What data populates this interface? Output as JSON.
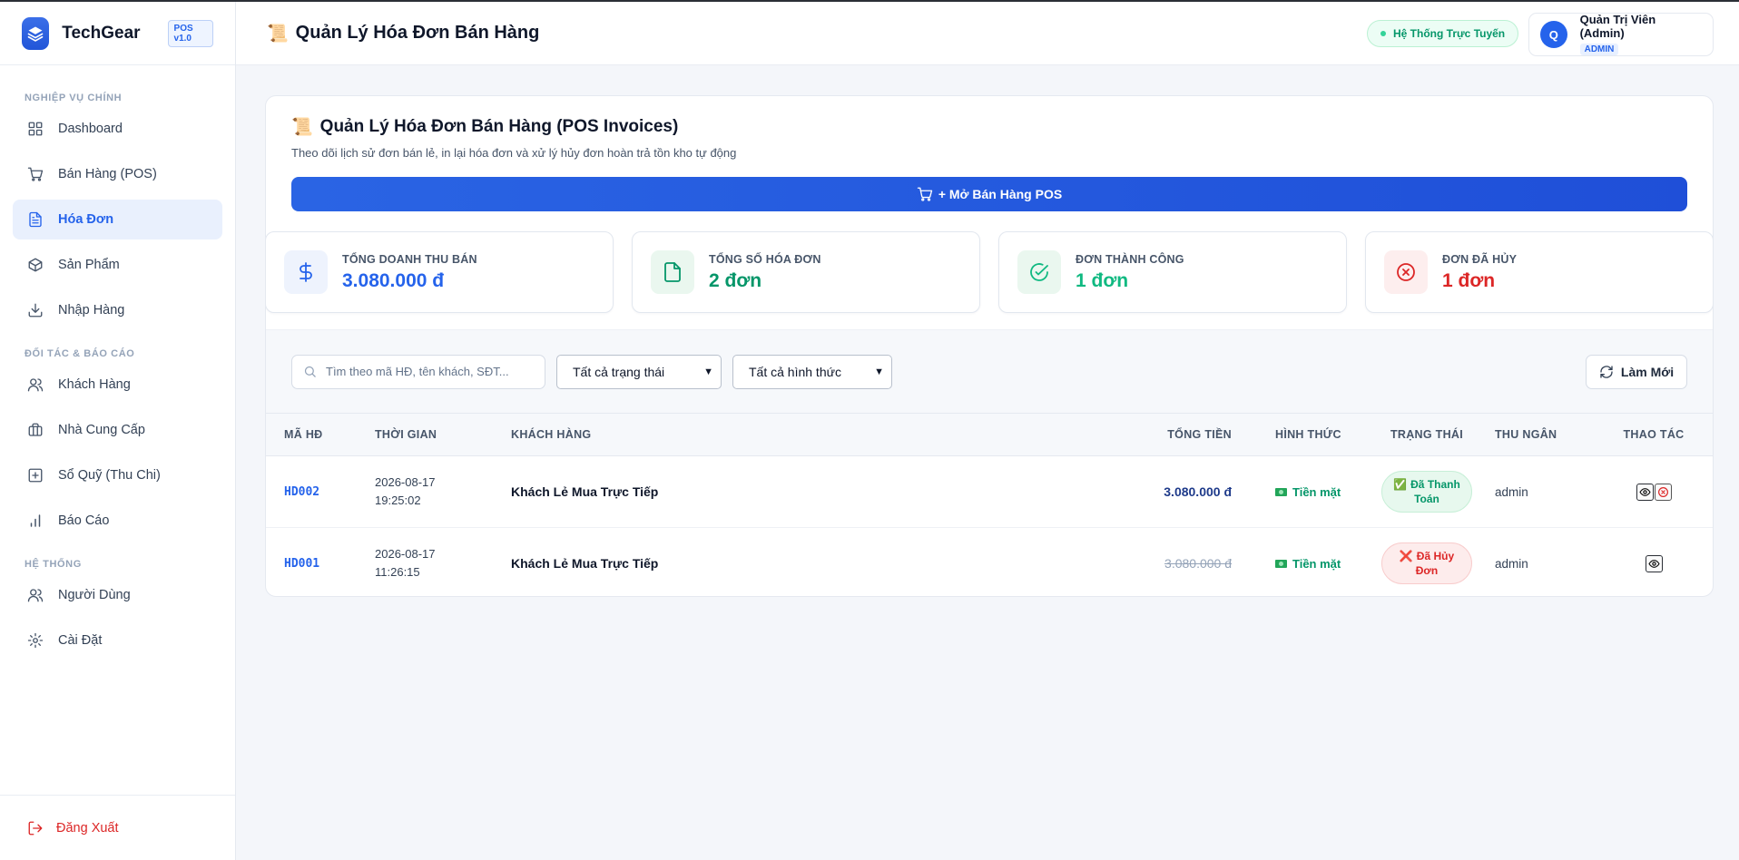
{
  "brand": {
    "name": "TechGear",
    "badge": "POS v1.0",
    "logo_icon": "layers-icon"
  },
  "sidebar": {
    "sections": [
      {
        "title": "NGHIỆP VỤ CHÍNH"
      },
      {
        "title": "ĐỐI TÁC & BÁO CÁO"
      },
      {
        "title": "HỆ THỐNG"
      }
    ],
    "items": [
      {
        "label": "Dashboard",
        "icon": "grid-icon"
      },
      {
        "label": "Bán Hàng (POS)",
        "icon": "cart-icon"
      },
      {
        "label": "Hóa Đơn",
        "icon": "file-icon",
        "active": true
      },
      {
        "label": "Sản Phẩm",
        "icon": "box-icon"
      },
      {
        "label": "Nhập Hàng",
        "icon": "download-icon"
      },
      {
        "label": "Khách Hàng",
        "icon": "users-icon"
      },
      {
        "label": "Nhà Cung Cấp",
        "icon": "briefcase-icon"
      },
      {
        "label": "Sổ Quỹ (Thu Chi)",
        "icon": "plus-square-icon"
      },
      {
        "label": "Báo Cáo",
        "icon": "bar-chart-icon"
      },
      {
        "label": "Người Dùng",
        "icon": "users-icon"
      },
      {
        "label": "Cài Đặt",
        "icon": "settings-icon"
      }
    ],
    "logout": "Đăng Xuất"
  },
  "header": {
    "title": "Quản Lý Hóa Đơn Bán Hàng",
    "title_emoji": "📜",
    "status": "Hệ Thống Trực Tuyến",
    "user": {
      "initial": "Q",
      "name": "Quản Trị Viên (Admin)",
      "role": "ADMIN"
    }
  },
  "page": {
    "title": "Quản Lý Hóa Đơn Bán Hàng (POS Invoices)",
    "title_emoji": "📜",
    "subtitle": "Theo dõi lịch sử đơn bán lẻ, in lại hóa đơn và xử lý hủy đơn hoàn trả tồn kho tự động",
    "pos_button": "+ Mở Bán Hàng POS"
  },
  "stats": [
    {
      "label": "TỔNG DOANH THU BÁN",
      "value": "3.080.000 đ",
      "icon": "dollar-icon",
      "color": "#2563eb",
      "bg": "#eef3fd"
    },
    {
      "label": "TỔNG SỐ HÓA ĐƠN",
      "value": "2 đơn",
      "icon": "file-icon",
      "color": "#059669",
      "bg": "#eaf7ef"
    },
    {
      "label": "ĐƠN THÀNH CÔNG",
      "value": "1 đơn",
      "icon": "check-circle-icon",
      "color": "#10b981",
      "bg": "#eaf7ef"
    },
    {
      "label": "ĐƠN ĐÃ HỦY",
      "value": "1 đơn",
      "icon": "x-circle-icon",
      "color": "#dc2626",
      "bg": "#fdeeee"
    }
  ],
  "filters": {
    "search_placeholder": "Tìm theo mã HĐ, tên khách, SĐT...",
    "status_select": "Tất cả trạng thái",
    "method_select": "Tất cả hình thức",
    "refresh": "Làm Mới"
  },
  "table": {
    "headers": [
      "MÃ HĐ",
      "THỜI GIAN",
      "KHÁCH HÀNG",
      "TỔNG TIỀN",
      "HÌNH THỨC",
      "TRẠNG THÁI",
      "THU NGÂN",
      "THAO TÁC"
    ],
    "rows": [
      {
        "id": "HD002",
        "date": "2026-08-17",
        "time": "19:25:02",
        "customer": "Khách Lẻ Mua Trực Tiếp",
        "total": "3.080.000 đ",
        "method": "Tiền mặt",
        "status_line1": "Đã Thanh",
        "status_line2": "Toán",
        "status_type": "paid",
        "cashier": "admin"
      },
      {
        "id": "HD001",
        "date": "2026-08-17",
        "time": "11:26:15",
        "customer": "Khách Lẻ Mua Trực Tiếp",
        "total": "3.080.000 đ",
        "method": "Tiền mặt",
        "status_line1": "Đã Hủy",
        "status_line2": "Đơn",
        "status_type": "cancel",
        "cashier": "admin"
      }
    ]
  }
}
